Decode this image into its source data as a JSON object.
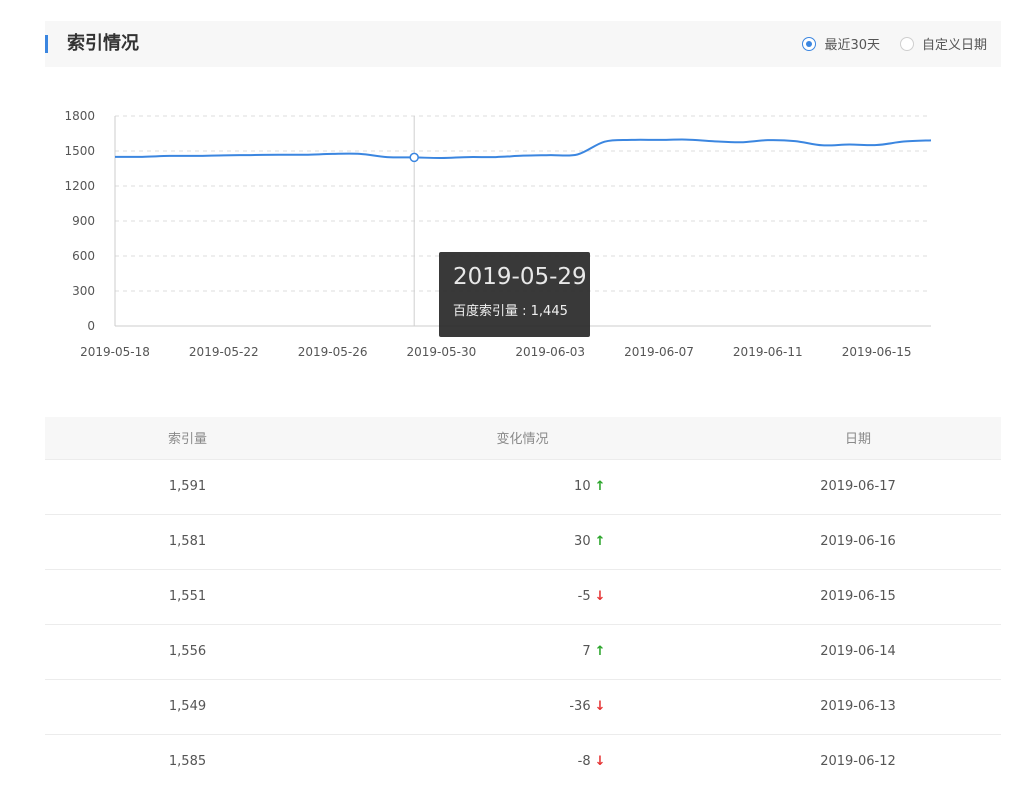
{
  "header": {
    "title": "索引情况",
    "options": [
      {
        "label": "最近30天",
        "checked": true
      },
      {
        "label": "自定义日期",
        "checked": false
      }
    ]
  },
  "colors": {
    "accent": "#3b86e0",
    "up": "#2aa52a",
    "down": "#e53333"
  },
  "chart_data": {
    "type": "line",
    "x": [
      "2019-05-18",
      "2019-05-19",
      "2019-05-20",
      "2019-05-21",
      "2019-05-22",
      "2019-05-23",
      "2019-05-24",
      "2019-05-25",
      "2019-05-26",
      "2019-05-27",
      "2019-05-28",
      "2019-05-29",
      "2019-05-30",
      "2019-05-31",
      "2019-06-01",
      "2019-06-02",
      "2019-06-03",
      "2019-06-04",
      "2019-06-05",
      "2019-06-06",
      "2019-06-07",
      "2019-06-08",
      "2019-06-09",
      "2019-06-10",
      "2019-06-11",
      "2019-06-12",
      "2019-06-13",
      "2019-06-14",
      "2019-06-15",
      "2019-06-16",
      "2019-06-17"
    ],
    "series": [
      {
        "values": [
          1450,
          1450,
          1458,
          1458,
          1463,
          1465,
          1468,
          1468,
          1475,
          1475,
          1448,
          1445,
          1440,
          1448,
          1448,
          1460,
          1465,
          1470,
          1580,
          1595,
          1595,
          1598,
          1584,
          1575,
          1593,
          1585,
          1549,
          1556,
          1551,
          1581,
          1591
        ]
      }
    ],
    "xticks": [
      "2019-05-18",
      "2019-05-22",
      "2019-05-26",
      "2019-05-30",
      "2019-06-03",
      "2019-06-07",
      "2019-06-11",
      "2019-06-15"
    ],
    "yticks": [
      0,
      300,
      600,
      900,
      1200,
      1500,
      1800
    ],
    "ylim": [
      0,
      1800
    ],
    "grid": true,
    "highlight": {
      "date": "2019-05-29",
      "value": 1445
    }
  },
  "tooltip": {
    "date": "2019-05-29",
    "line": "百度索引量 : 1,445"
  },
  "table": {
    "headers": [
      "索引量",
      "变化情况",
      "日期"
    ],
    "rows": [
      {
        "count": "1,591",
        "change": "10",
        "dir": "up",
        "date": "2019-06-17"
      },
      {
        "count": "1,581",
        "change": "30",
        "dir": "up",
        "date": "2019-06-16"
      },
      {
        "count": "1,551",
        "change": "-5",
        "dir": "down",
        "date": "2019-06-15"
      },
      {
        "count": "1,556",
        "change": "7",
        "dir": "up",
        "date": "2019-06-14"
      },
      {
        "count": "1,549",
        "change": "-36",
        "dir": "down",
        "date": "2019-06-13"
      },
      {
        "count": "1,585",
        "change": "-8",
        "dir": "down",
        "date": "2019-06-12"
      }
    ]
  }
}
